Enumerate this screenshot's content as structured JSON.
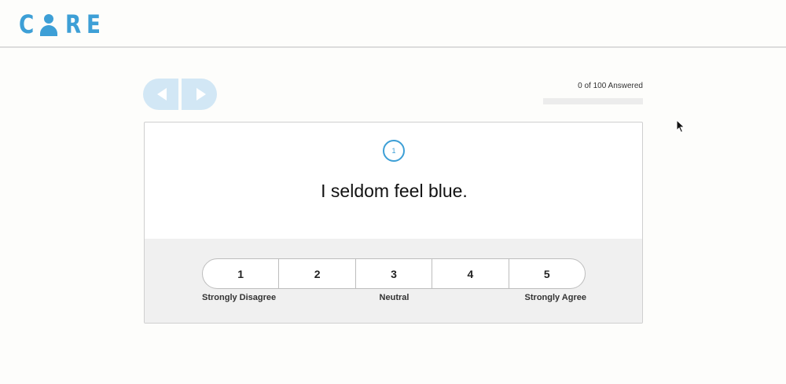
{
  "header": {
    "logo_letters": [
      "C",
      "R",
      "E"
    ]
  },
  "navigation": {
    "prev_icon": "triangle-left-icon",
    "next_icon": "triangle-right-icon"
  },
  "progress": {
    "text": "0 of 100 Answered",
    "answered": 0,
    "total": 100
  },
  "question": {
    "number": "1",
    "text": "I seldom feel blue."
  },
  "scale": {
    "options": [
      "1",
      "2",
      "3",
      "4",
      "5"
    ],
    "label_left": "Strongly Disagree",
    "label_mid": "Neutral",
    "label_right": "Strongly Agree"
  },
  "colors": {
    "accent": "#3d9fd6",
    "nav_bg": "#d2e7f5"
  }
}
